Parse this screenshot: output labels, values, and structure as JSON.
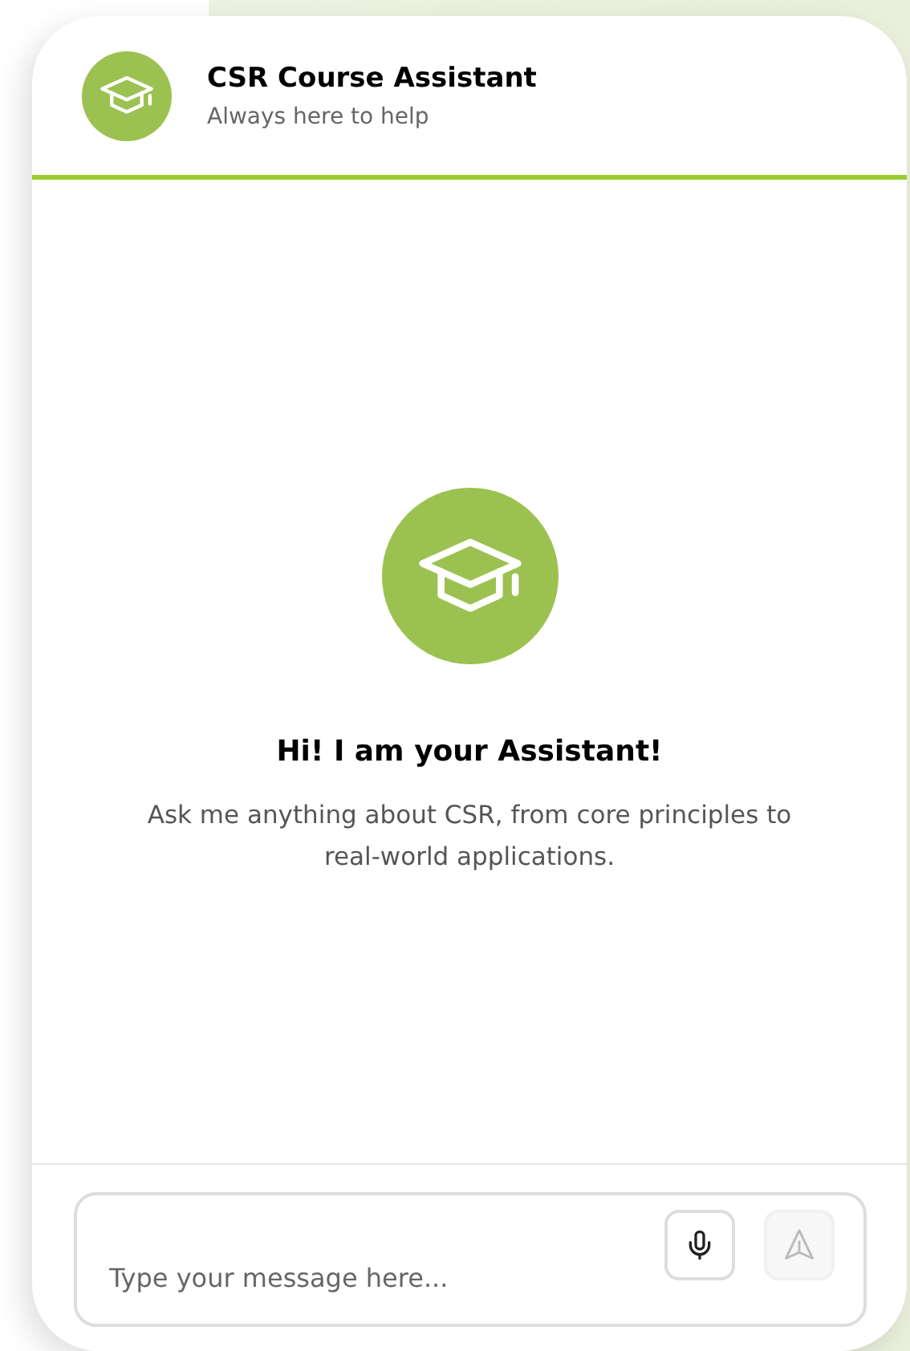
{
  "header": {
    "title": "CSR Course Assistant",
    "subtitle": "Always here to help"
  },
  "welcome": {
    "heading": "Hi! I am your Assistant!",
    "text": "Ask me anything about CSR, from core principles to real-world applications."
  },
  "composer": {
    "placeholder": "Type your message here...",
    "send_disabled": true
  }
}
